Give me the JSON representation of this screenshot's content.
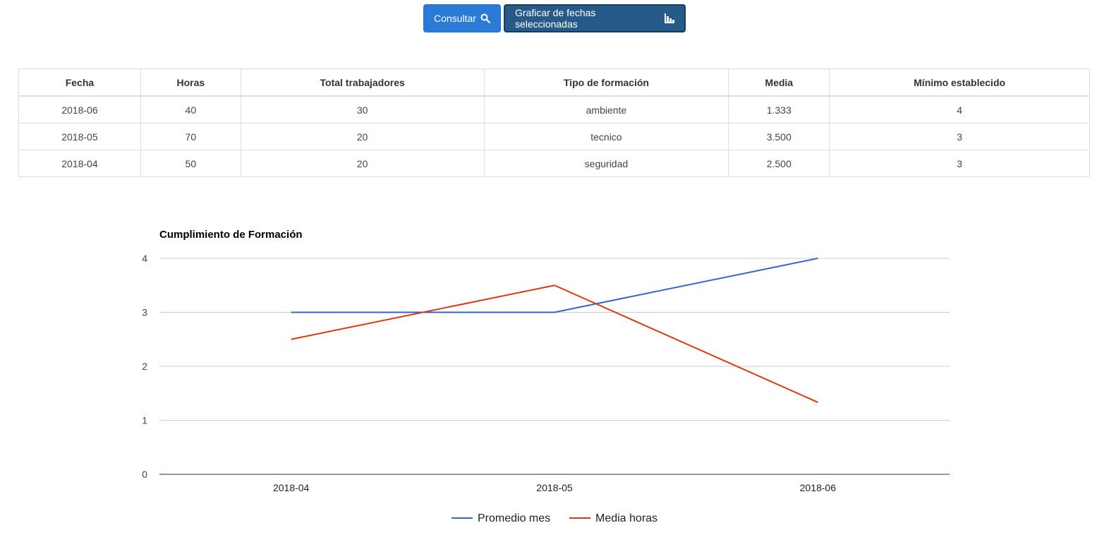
{
  "toolbar": {
    "consultar_label": "Consultar",
    "graficar_label": "Graficar de fechas seleccionadas"
  },
  "table": {
    "headers": [
      "Fecha",
      "Horas",
      "Total trabajadores",
      "Tipo de formación",
      "Media",
      "Mínimo establecido"
    ],
    "rows": [
      [
        "2018-06",
        "40",
        "30",
        "ambiente",
        "1.333",
        "4"
      ],
      [
        "2018-05",
        "70",
        "20",
        "tecnico",
        "3.500",
        "3"
      ],
      [
        "2018-04",
        "50",
        "20",
        "seguridad",
        "2.500",
        "3"
      ]
    ]
  },
  "chart_data": {
    "type": "line",
    "title": "Cumplimiento de Formación",
    "categories": [
      "2018-04",
      "2018-05",
      "2018-06"
    ],
    "ylim": [
      0,
      4
    ],
    "yticks": [
      "0",
      "1",
      "2",
      "3",
      "4"
    ],
    "grid": true,
    "legend_position": "bottom",
    "series": [
      {
        "name": "Promedio mes",
        "color": "#3366cc",
        "values": [
          3,
          3,
          4
        ]
      },
      {
        "name": "Media horas",
        "color": "#dc3912",
        "values": [
          2.5,
          3.5,
          1.333
        ]
      }
    ]
  }
}
